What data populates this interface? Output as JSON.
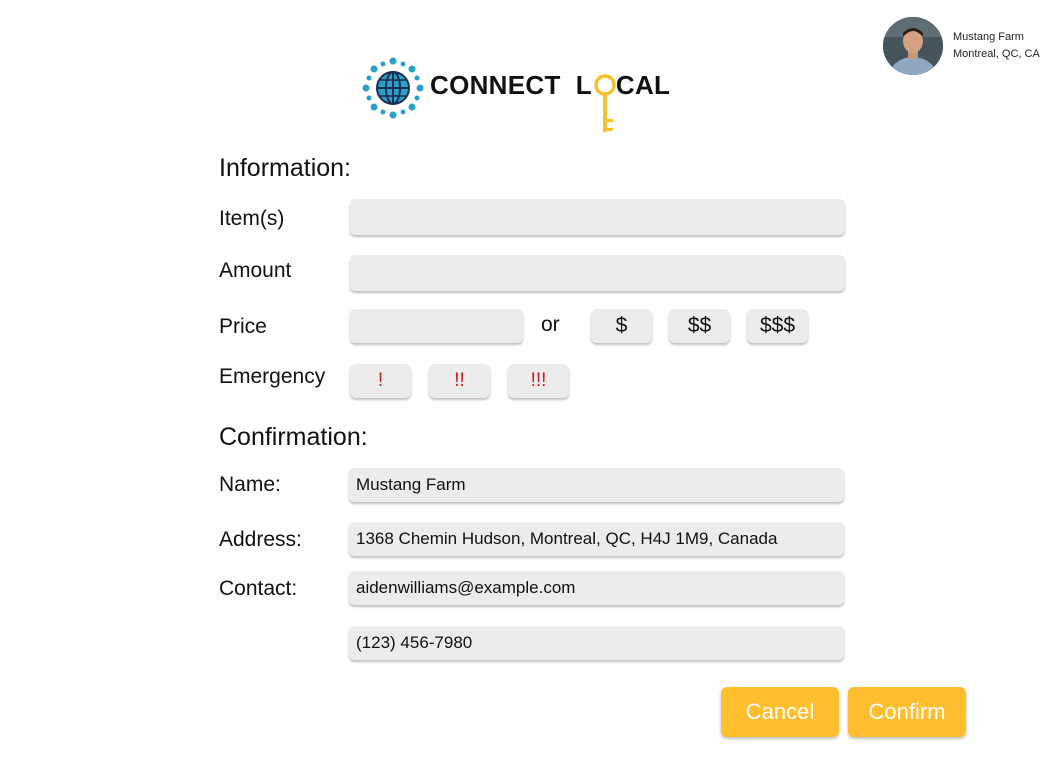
{
  "profile": {
    "name": "Mustang Farm",
    "location": "Montreal, QC, CA"
  },
  "logo": {
    "text_part1": "CONNECT  L",
    "text_part2": "CAL"
  },
  "information": {
    "heading": "Information:",
    "item_label": "Item(s)",
    "amount_label": "Amount",
    "price_label": "Price",
    "price_or": "or",
    "price_options": [
      "$",
      "$$",
      "$$$"
    ],
    "emergency_label": "Emergency",
    "emergency_options": [
      "!",
      "!!",
      "!!!"
    ]
  },
  "confirmation": {
    "heading": "Confirmation:",
    "name_label": "Name:",
    "name_value": "Mustang Farm",
    "address_label": "Address:",
    "address_value": "1368 Chemin Hudson, Montreal, QC, H4J 1M9, Canada",
    "contact_label": "Contact:",
    "email_value": "aidenwilliams@example.com",
    "phone_value": "(123) 456-7980"
  },
  "actions": {
    "cancel": "Cancel",
    "confirm": "Confirm"
  },
  "colors": {
    "accent": "#ffbe2d",
    "globe": "#2a9fc7",
    "emergency": "#cc1b1b",
    "field": "#ececec"
  }
}
